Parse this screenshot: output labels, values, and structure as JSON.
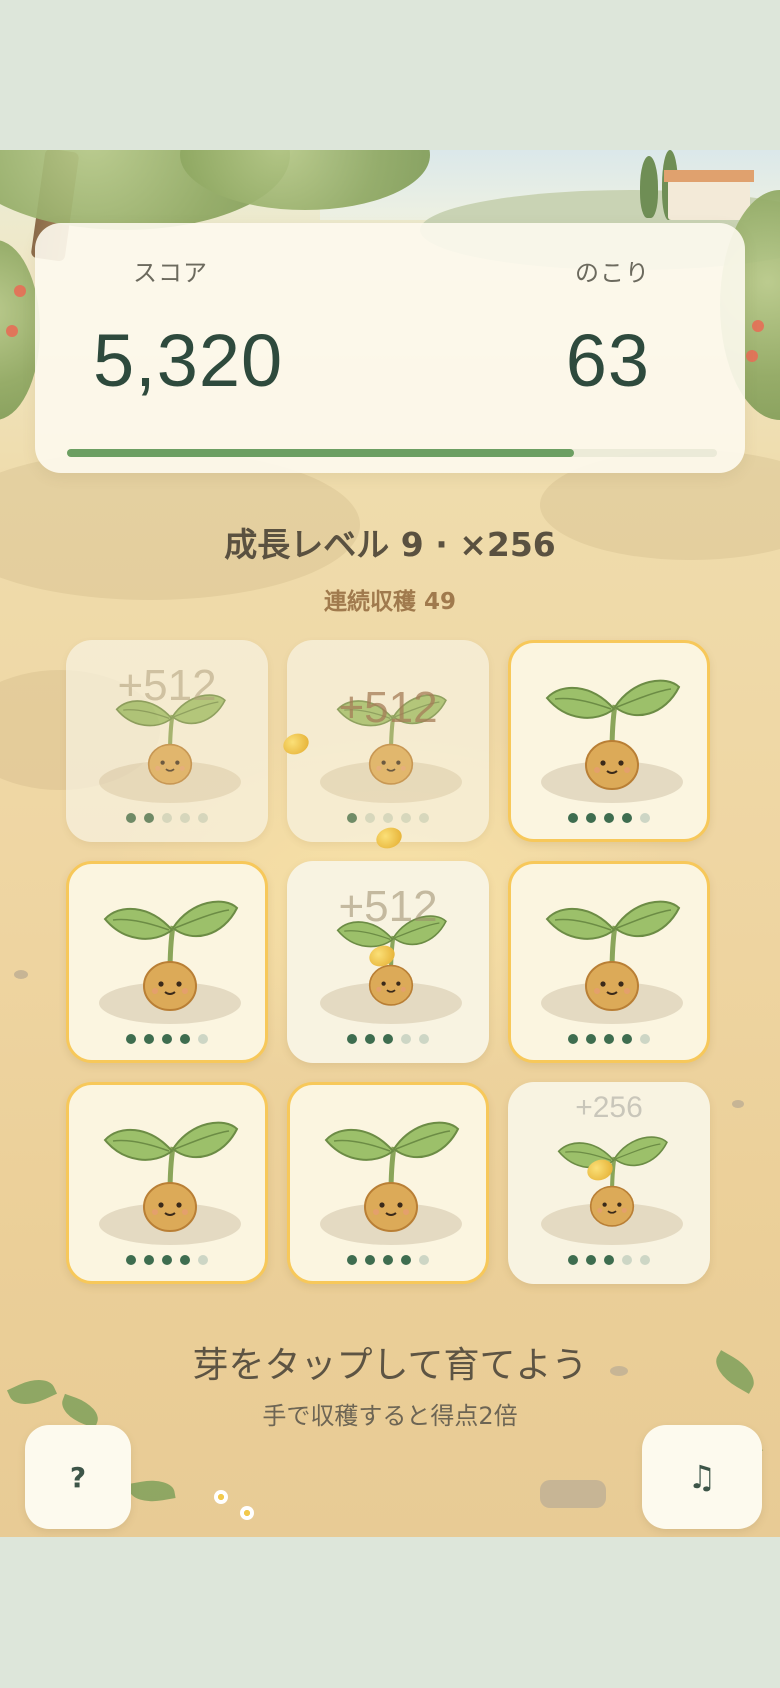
{
  "hud": {
    "score_label": "スコア",
    "score_value": "5,320",
    "remaining_label": "のこり",
    "remaining_value": "63",
    "time_progress": 0.78
  },
  "level_text": "成長レベル 9 · ×256",
  "combo_text": "連続収穫 49",
  "tiles": [
    {
      "growth": 2,
      "max": 5,
      "ripe": false,
      "float": "+512"
    },
    {
      "growth": 1,
      "max": 5,
      "ripe": false,
      "float": "+512"
    },
    {
      "growth": 4,
      "max": 5,
      "ripe": true,
      "float": ""
    },
    {
      "growth": 4,
      "max": 5,
      "ripe": true,
      "float": ""
    },
    {
      "growth": 3,
      "max": 5,
      "ripe": false,
      "float": "+512"
    },
    {
      "growth": 4,
      "max": 5,
      "ripe": true,
      "float": ""
    },
    {
      "growth": 4,
      "max": 5,
      "ripe": true,
      "float": ""
    },
    {
      "growth": 4,
      "max": 5,
      "ripe": true,
      "float": ""
    },
    {
      "growth": 3,
      "max": 5,
      "ripe": false,
      "float": "+256"
    }
  ],
  "instructions": {
    "main": "芽をタップして育てよう",
    "sub": "手で収穫すると得点2倍"
  },
  "buttons": {
    "help": "?",
    "music": "♫"
  },
  "colors": {
    "accent_green": "#6c9f62",
    "ripe_border": "#f7c85a",
    "text_dark": "#2e4a3d"
  }
}
